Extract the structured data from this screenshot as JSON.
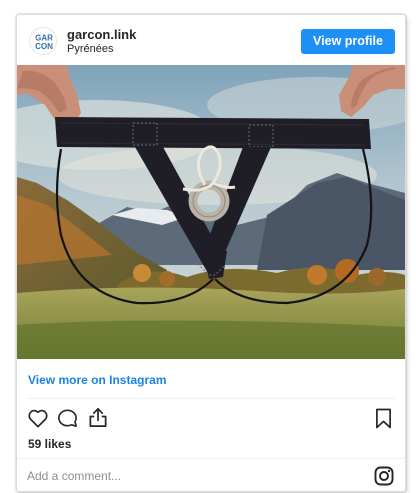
{
  "post": {
    "username": "garcon.link",
    "location": "Pyrénées",
    "view_profile_label": "View profile",
    "avatar_logo_text": [
      "GAR",
      "CON"
    ],
    "view_more_label": "View more on Instagram",
    "likes": "59 likes",
    "comment_placeholder": "Add a comment...",
    "icons": [
      "heart-icon",
      "comment-icon",
      "share-icon",
      "bookmark-icon",
      "instagram-icon"
    ]
  },
  "colors": {
    "button_blue": "#1e90f5",
    "link_blue": "#1a83e6",
    "text": "#262626",
    "muted": "#8e8e8e",
    "border": "#dbdbdb"
  }
}
